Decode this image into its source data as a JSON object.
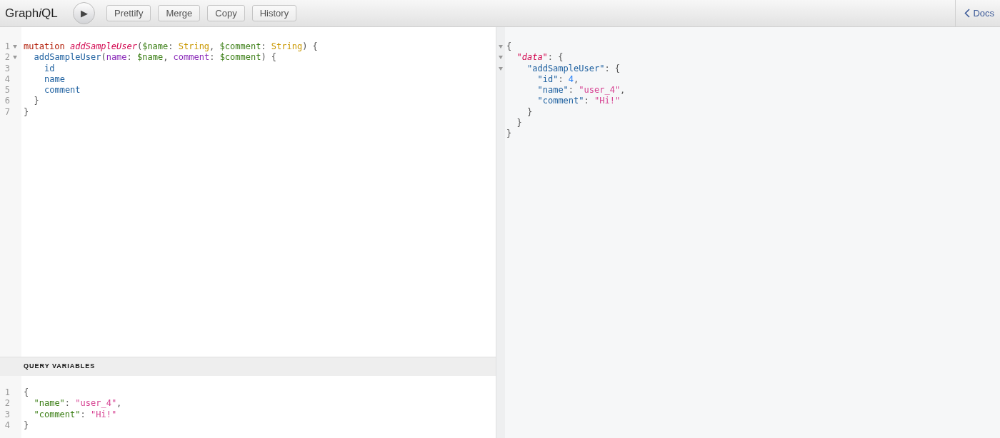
{
  "toolbar": {
    "title": [
      {
        "text": "Graph",
        "italic": false
      },
      {
        "text": "i",
        "italic": true
      },
      {
        "text": "QL",
        "italic": false
      }
    ],
    "run_button": "▶",
    "buttons": [
      "Prettify",
      "Merge",
      "Copy",
      "History"
    ],
    "docs": "Docs"
  },
  "query_editor": {
    "lines": [
      {
        "number": "1",
        "foldable": true,
        "tokens": [
          {
            "kind": "keyword",
            "text": "mutation"
          },
          {
            "kind": "def",
            "text": "addSampleUser"
          },
          {
            "kind": "punct",
            "text": "("
          },
          {
            "kind": "variable",
            "text": "$name"
          },
          {
            "kind": "punct",
            "text": ": "
          },
          {
            "kind": "type",
            "text": "String"
          },
          {
            "kind": "punct",
            "text": ", "
          },
          {
            "kind": "variable",
            "text": "$comment"
          },
          {
            "kind": "punct",
            "text": ": "
          },
          {
            "kind": "type",
            "text": "String"
          },
          {
            "kind": "punct",
            "text": ") {"
          }
        ]
      },
      {
        "number": "2",
        "foldable": true,
        "tokens": [
          {
            "kind": "property",
            "text": "addSampleUser"
          },
          {
            "kind": "punct",
            "text": "("
          },
          {
            "kind": "attribute",
            "text": "name"
          },
          {
            "kind": "punct",
            "text": ": "
          },
          {
            "kind": "variable",
            "text": "$name"
          },
          {
            "kind": "punct",
            "text": ", "
          },
          {
            "kind": "attribute",
            "text": "comment"
          },
          {
            "kind": "punct",
            "text": ": "
          },
          {
            "kind": "variable",
            "text": "$comment"
          },
          {
            "kind": "punct",
            "text": ") {"
          }
        ]
      },
      {
        "number": "3",
        "foldable": false,
        "tokens": [
          {
            "kind": "property",
            "text": "id"
          }
        ]
      },
      {
        "number": "4",
        "foldable": false,
        "tokens": [
          {
            "kind": "property",
            "text": "name"
          }
        ]
      },
      {
        "number": "5",
        "foldable": false,
        "tokens": [
          {
            "kind": "property",
            "text": "comment"
          }
        ]
      },
      {
        "number": "6",
        "foldable": false,
        "tokens": [
          {
            "kind": "punct",
            "text": "}"
          }
        ]
      },
      {
        "number": "7",
        "foldable": false,
        "tokens": [
          {
            "kind": "punct",
            "text": "}"
          }
        ]
      }
    ]
  },
  "variables_editor": {
    "title": "QUERY VARIABLES",
    "lines": [
      {
        "number": "1",
        "tokens": [
          {
            "kind": "punct",
            "text": "{"
          }
        ]
      },
      {
        "number": "2",
        "tokens": [
          {
            "kind": "varkey",
            "text": "\"name\""
          },
          {
            "kind": "punct",
            "text": ": "
          },
          {
            "kind": "string",
            "text": "\"user_4\""
          },
          {
            "kind": "punct",
            "text": ","
          }
        ]
      },
      {
        "number": "3",
        "tokens": [
          {
            "kind": "varkey",
            "text": "\"comment\""
          },
          {
            "kind": "punct",
            "text": ": "
          },
          {
            "kind": "string",
            "text": "\"Hi!\""
          }
        ]
      },
      {
        "number": "4",
        "tokens": [
          {
            "kind": "punct",
            "text": "}"
          }
        ]
      }
    ]
  },
  "result_viewer": {
    "lines": [
      {
        "foldable": true,
        "tokens": [
          {
            "kind": "punct",
            "text": "{"
          }
        ]
      },
      {
        "foldable": true,
        "tokens": [
          {
            "kind": "def",
            "text": "\"data\""
          },
          {
            "kind": "punct",
            "text": ": {"
          }
        ]
      },
      {
        "foldable": true,
        "tokens": [
          {
            "kind": "property",
            "text": "\"addSampleUser\""
          },
          {
            "kind": "punct",
            "text": ": {"
          }
        ]
      },
      {
        "foldable": false,
        "tokens": [
          {
            "kind": "property",
            "text": "\"id\""
          },
          {
            "kind": "punct",
            "text": ": "
          },
          {
            "kind": "number",
            "text": "4"
          },
          {
            "kind": "punct",
            "text": ","
          }
        ]
      },
      {
        "foldable": false,
        "tokens": [
          {
            "kind": "property",
            "text": "\"name\""
          },
          {
            "kind": "punct",
            "text": ": "
          },
          {
            "kind": "string",
            "text": "\"user_4\""
          },
          {
            "kind": "punct",
            "text": ","
          }
        ]
      },
      {
        "foldable": false,
        "tokens": [
          {
            "kind": "property",
            "text": "\"comment\""
          },
          {
            "kind": "punct",
            "text": ": "
          },
          {
            "kind": "string",
            "text": "\"Hi!\""
          }
        ]
      },
      {
        "foldable": false,
        "tokens": [
          {
            "kind": "punct",
            "text": "}"
          }
        ]
      },
      {
        "foldable": false,
        "tokens": [
          {
            "kind": "punct",
            "text": "}"
          }
        ]
      },
      {
        "foldable": false,
        "tokens": [
          {
            "kind": "punct",
            "text": "}"
          }
        ]
      }
    ]
  }
}
